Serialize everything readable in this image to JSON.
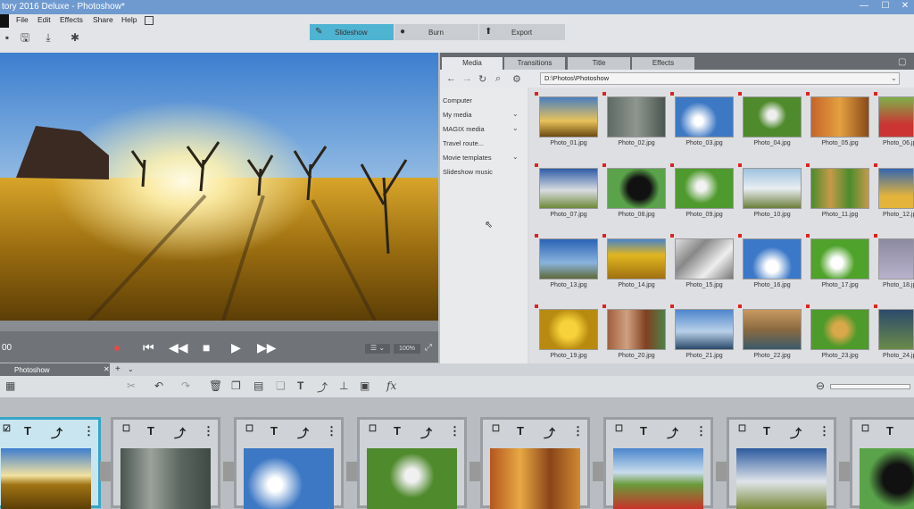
{
  "window": {
    "title": "tory 2016 Deluxe - Photoshow*",
    "min": "—",
    "max": "☐",
    "close": "✕"
  },
  "menu": [
    "File",
    "Edit",
    "Effects",
    "Share",
    "Help"
  ],
  "modes": [
    {
      "label": "Slideshow",
      "active": true
    },
    {
      "label": "Burn",
      "active": false
    },
    {
      "label": "Export",
      "active": false
    }
  ],
  "media_tabs": [
    "Media",
    "Transitions",
    "Title",
    "Effects"
  ],
  "path": "D:\\Photos\\Photoshow",
  "tree": [
    "Computer",
    "My media",
    "MAGIX media",
    "Travel route...",
    "Movie templates",
    "Slideshow music"
  ],
  "photos": [
    "Photo_01.jpg",
    "Photo_02.jpg",
    "Photo_03.jpg",
    "Photo_04.jpg",
    "Photo_05.jpg",
    "Photo_06.jpg",
    "Photo_07.jpg",
    "Photo_08.jpg",
    "Photo_09.jpg",
    "Photo_10.jpg",
    "Photo_11.jpg",
    "Photo_12.jpg",
    "Photo_13.jpg",
    "Photo_14.jpg",
    "Photo_15.jpg",
    "Photo_16.jpg",
    "Photo_17.jpg",
    "Photo_18.jpg",
    "Photo_19.jpg",
    "Photo_20.jpg",
    "Photo_21.jpg",
    "Photo_22.jpg",
    "Photo_23.jpg",
    "Photo_24.jpg"
  ],
  "player": {
    "time": "00",
    "zoom": "100%"
  },
  "timeline": {
    "tab": "Photoshow",
    "add": "+"
  },
  "colors": {
    "accent": "#35a6c8",
    "title_bar": "#6e9ad0",
    "flag": "#d22222"
  }
}
